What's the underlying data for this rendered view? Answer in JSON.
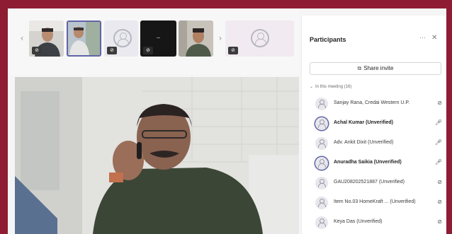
{
  "panel": {
    "title": "Participants",
    "more_label": "···",
    "close_label": "✕",
    "share_invite_label": "Share invite",
    "section_label": "In this meeting (16)"
  },
  "participants": [
    {
      "name": "Sanjay Rana, Credai Western U.P.",
      "mic": "muted",
      "active": false,
      "bold": false
    },
    {
      "name": "Achal Kumar (Unverified)",
      "mic": "on",
      "active": true,
      "bold": true
    },
    {
      "name": "Adv. Ankit Dixit (Unverified)",
      "mic": "on",
      "active": false,
      "bold": false
    },
    {
      "name": "Anuradha Saikia (Unverified)",
      "mic": "on",
      "active": true,
      "bold": true
    },
    {
      "name": "GAU208202521887 (Unverified)",
      "mic": "muted",
      "active": false,
      "bold": false
    },
    {
      "name": "Item No.03 HomeKraft ... (Unverified)",
      "mic": "muted",
      "active": false,
      "bold": false
    },
    {
      "name": "Keya Das (Unverified)",
      "mic": "muted",
      "active": false,
      "bold": false
    }
  ],
  "icons": {
    "strip_prev": "chevron-left-icon",
    "strip_next": "chevron-right-icon",
    "share": "share-icon",
    "mic_on": "microphone-icon",
    "mic_off": "microphone-muted-icon",
    "avatar": "person-icon"
  },
  "colors": {
    "frame": "#8e1d33",
    "accent": "#6264a7"
  }
}
